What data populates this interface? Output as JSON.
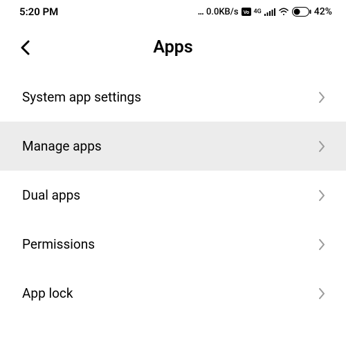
{
  "statusBar": {
    "time": "5:20 PM",
    "dots": "...",
    "speed": "0.0KB/s",
    "network": "4G",
    "batteryPercent": "42%"
  },
  "header": {
    "title": "Apps"
  },
  "items": [
    {
      "label": "System app settings",
      "highlighted": false
    },
    {
      "label": "Manage apps",
      "highlighted": true
    },
    {
      "label": "Dual apps",
      "highlighted": false
    },
    {
      "label": "Permissions",
      "highlighted": false
    },
    {
      "label": "App lock",
      "highlighted": false
    }
  ]
}
